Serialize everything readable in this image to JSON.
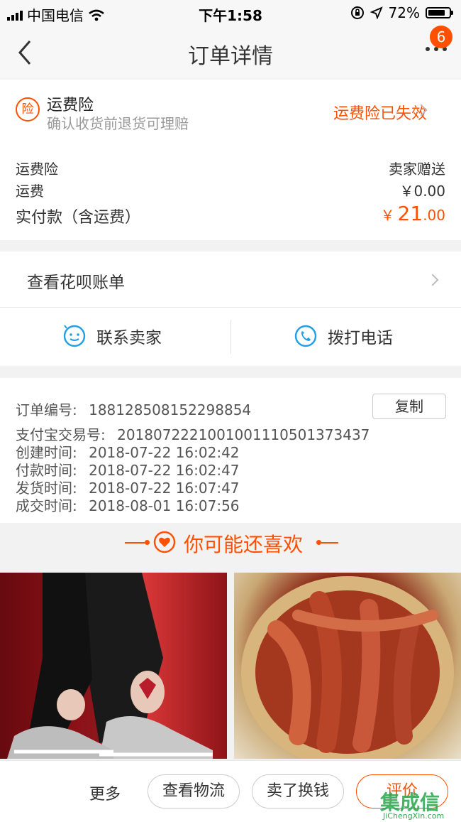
{
  "status_bar": {
    "carrier": "中国电信",
    "time": "下午1:58",
    "battery": "72%"
  },
  "nav": {
    "title": "订单详情",
    "badge": "6"
  },
  "insurance": {
    "icon_text": "险",
    "title": "运费险",
    "subtitle": "确认收货前退货可理赔",
    "status": "运费险已失效"
  },
  "fees": [
    {
      "label": "运费险",
      "value": "卖家赠送"
    },
    {
      "label": "运费",
      "value": "￥0.00"
    }
  ],
  "paid": {
    "label": "实付款（含运费）",
    "currency": "￥",
    "int": "21",
    "dec": ".00"
  },
  "huabei": {
    "label": "查看花呗账单"
  },
  "contact": {
    "seller": "联系卖家",
    "phone": "拨打电话"
  },
  "order": {
    "copy": "复制",
    "rows": [
      {
        "label": "订单编号:",
        "value": "188128508152298854"
      },
      {
        "label": "支付宝交易号:",
        "value": "2018072221001001110501373437"
      },
      {
        "label": "创建时间:",
        "value": "2018-07-22 16:02:42"
      },
      {
        "label": "付款时间:",
        "value": "2018-07-22 16:02:47"
      },
      {
        "label": "发货时间:",
        "value": "2018-07-22 16:07:47"
      },
      {
        "label": "成交时间:",
        "value": "2018-08-01 16:07:56"
      }
    ]
  },
  "recommend": {
    "title": "你可能还喜欢"
  },
  "bottom": {
    "more": "更多",
    "logistics": "查看物流",
    "resell": "卖了换钱",
    "review": "评价"
  },
  "watermark": {
    "text": "集成信",
    "url": "JiChengXin.com"
  }
}
